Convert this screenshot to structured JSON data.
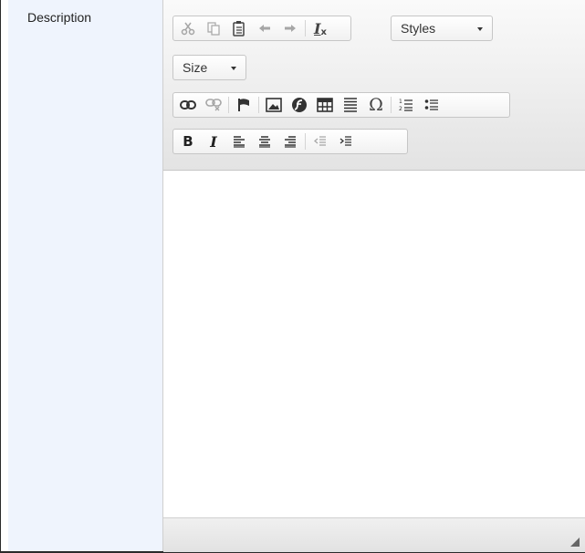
{
  "form": {
    "field_label": "Description"
  },
  "editor": {
    "styles_combo": "Styles",
    "size_combo": "Size",
    "toolbar_icons": {
      "clipboard": [
        "cut-icon",
        "copy-icon",
        "paste-from-word-icon",
        "undo-icon",
        "redo-icon",
        "remove-format-icon"
      ],
      "insert": [
        "link-icon",
        "unlink-icon",
        "anchor-icon",
        "image-icon",
        "flash-icon",
        "table-icon",
        "horizontal-rule-icon",
        "special-char-icon",
        "numbered-list-icon",
        "bulleted-list-icon"
      ],
      "format": [
        "bold-icon",
        "italic-icon",
        "align-left-icon",
        "align-center-icon",
        "align-right-icon",
        "outdent-icon",
        "indent-icon"
      ]
    },
    "content": ""
  }
}
